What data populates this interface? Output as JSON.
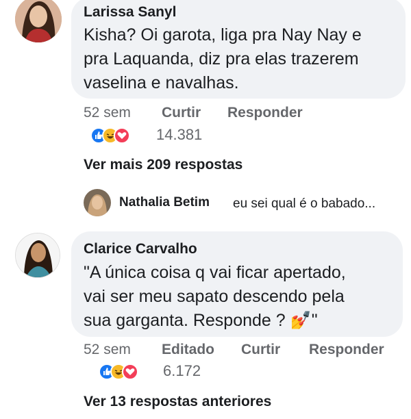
{
  "comments": [
    {
      "author": "Larissa Sanyl",
      "lines": [
        "Kisha? Oi garota, liga pra Nay Nay e",
        "pra Laquanda, diz pra elas trazerem",
        "vaselina e navalhas."
      ],
      "time": "52 sem",
      "like_label": "Curtir",
      "reply_label": "Responder",
      "reactions": [
        "like-icon",
        "haha-icon",
        "love-icon"
      ],
      "reaction_count": "14.381",
      "view_more": "Ver mais 209 respostas"
    },
    {
      "author": "Clarice Carvalho",
      "lines": [
        "\"A única coisa q vai ficar apertado,",
        "vai ser meu sapato descendo pela",
        "sua garganta. Responde ? 💅\""
      ],
      "time": "52 sem",
      "edited_label": "Editado",
      "like_label": "Curtir",
      "reply_label": "Responder",
      "reactions": [
        "like-icon",
        "haha-icon",
        "love-icon"
      ],
      "reaction_count": "6.172",
      "view_more": "Ver 13 respostas anteriores"
    }
  ],
  "reply_preview": {
    "author": "Nathalia Betim",
    "text": "eu sei qual é o babado..."
  },
  "colors": {
    "bubble": "#f0f2f5",
    "meta": "#65676b",
    "like": "#1877f2",
    "haha": "#f7b928",
    "love": "#f33e58"
  }
}
